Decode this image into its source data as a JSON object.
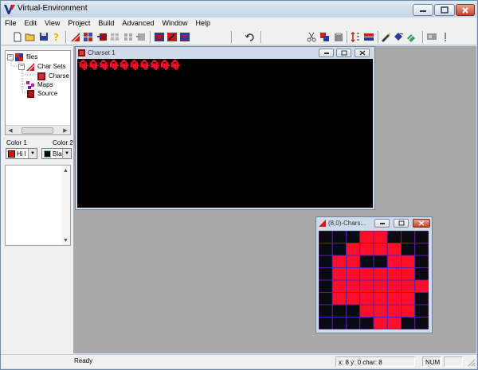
{
  "app": {
    "title": "Virtual-Environment",
    "logo_letter": "V"
  },
  "menu": [
    "File",
    "Edit",
    "View",
    "Project",
    "Build",
    "Advanced",
    "Window",
    "Help"
  ],
  "toolbar": {
    "icons": [
      "new-file-icon",
      "open-folder-icon",
      "save-icon",
      "help-icon",
      "charset-editor-icon",
      "map-grid-icon",
      "export-icon",
      "grid-small-icon",
      "grid-gray-icon",
      "tile-gray-icon",
      "charset-red-icon",
      "map-red-icon",
      "list-red-icon",
      "undo-icon",
      "cut-icon",
      "copy-icon",
      "paste-icon",
      "flip-vertical-icon",
      "swap-icon",
      "pencil-icon",
      "fill-tool-icon",
      "eraser-icon",
      "screen-icon",
      "info-icon"
    ]
  },
  "tree": {
    "items": [
      {
        "label": "files",
        "expander": "−",
        "icon": "files-folder-icon",
        "level": 0
      },
      {
        "label": "Char Sets",
        "expander": "−",
        "icon": "char-sets-icon",
        "level": 1
      },
      {
        "label": "Charse",
        "expander": "",
        "icon": "charset-item-icon",
        "level": 2
      },
      {
        "label": "Maps",
        "expander": "",
        "icon": "maps-icon",
        "level": 1
      },
      {
        "label": "Source",
        "expander": "",
        "icon": "source-icon",
        "level": 1
      }
    ]
  },
  "colors": {
    "color1_label": "Color 1",
    "color2_label": "Color 2",
    "color1_value": "Hi l",
    "color2_value": "Bla",
    "color1_swatch": "#ff0000",
    "color2_swatch": "#000000"
  },
  "windows": {
    "charset": {
      "title": "Charset 1"
    },
    "char_editor": {
      "title": "(8,0)-Chars..."
    }
  },
  "char_grid": {
    "rows": 8,
    "cols": 8,
    "on_color": "#ff0d2a",
    "off_color": "#0a0a12",
    "line_color": "#5a1fa0",
    "bitmap": [
      "00011000",
      "00111100",
      "01100110",
      "01111110",
      "01111111",
      "01111110",
      "00011110",
      "00001100"
    ]
  },
  "status": {
    "ready_text": "Ready",
    "coords_text": "x: 8 y: 0 char: 8",
    "num_text": "NUM"
  }
}
